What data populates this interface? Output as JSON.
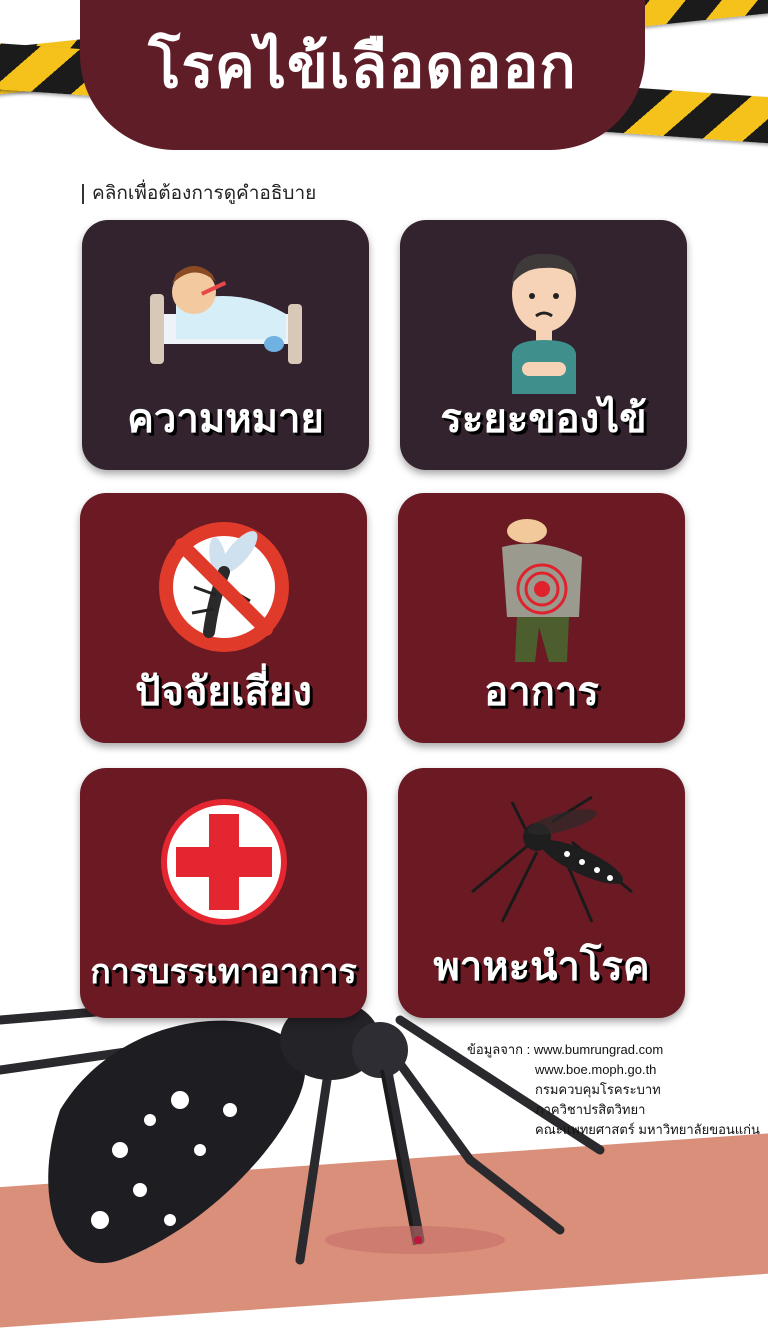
{
  "header": {
    "title": "โรคไข้เลือดออก"
  },
  "hint": {
    "text": "คลิกเพื่อต้องการดูคำอธิบาย"
  },
  "cards": [
    {
      "label": "ความหมาย",
      "icon": "sick-child-in-bed-icon"
    },
    {
      "label": "ระยะของไข้",
      "icon": "worried-man-icon"
    },
    {
      "label": "ปัจจัยเสี่ยง",
      "icon": "no-mosquito-icon"
    },
    {
      "label": "อาการ",
      "icon": "stomach-pain-icon"
    },
    {
      "label": "การบรรเทาอาการ",
      "icon": "red-cross-icon"
    },
    {
      "label": "พาหะนำโรค",
      "icon": "mosquito-icon"
    }
  ],
  "sources": {
    "prefix": "ข้อมูลจาก : ",
    "lines": [
      "www.bumrungrad.com",
      "www.boe.moph.go.th",
      "กรมควบคุมโรคระบาท",
      "ภาควิชาปรสิตวิทยา",
      "คณะแพทยศาสตร์ มหาวิทยาลัยขอนแก่น"
    ]
  },
  "colors": {
    "header": "#5e1d27",
    "card_dark": "#32232f",
    "card_wine": "#6b1a24",
    "tape_yellow": "#f4c21b"
  }
}
